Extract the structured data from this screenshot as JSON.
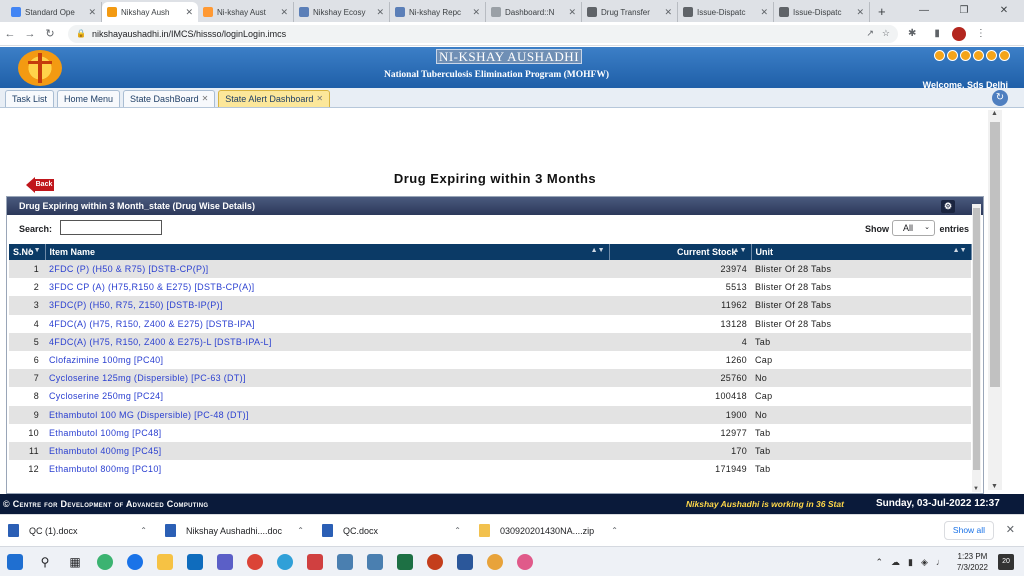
{
  "browser": {
    "tabs": [
      {
        "title": "Standard Ope",
        "color": "#4285f4",
        "active": false
      },
      {
        "title": "Nikshay Aush",
        "color": "#f39a12",
        "active": true
      },
      {
        "title": "Ni-kshay Aust",
        "color": "#ff9933",
        "active": false
      },
      {
        "title": "Nikshay Ecosy",
        "color": "#5b7fb8",
        "active": false
      },
      {
        "title": "Ni-kshay Repc",
        "color": "#5b7fb8",
        "active": false
      },
      {
        "title": "Dashboard::N",
        "color": "#9aa0a6",
        "active": false
      },
      {
        "title": "Drug Transfer",
        "color": "#5f6368",
        "active": false
      },
      {
        "title": "Issue-Dispatc",
        "color": "#5f6368",
        "active": false
      },
      {
        "title": "Issue-Dispatc",
        "color": "#5f6368",
        "active": false
      }
    ],
    "new_tab": "+",
    "url": "nikshayaushadhi.in/IMCS/hissso/loginLogin.imcs"
  },
  "app": {
    "brand": "NI-KSHAY AUSHADHI",
    "subtitle": "National Tuberculosis Elimination Program (MOHFW)",
    "welcome": "Welcome, Sds Delhi",
    "tabs": [
      {
        "label": "Task List",
        "closable": false,
        "active": false
      },
      {
        "label": "Home Menu",
        "closable": false,
        "active": false
      },
      {
        "label": "State DashBoard",
        "closable": true,
        "active": false
      },
      {
        "label": "State Alert Dashboard",
        "closable": true,
        "active": true
      }
    ]
  },
  "content": {
    "back_label": "Back",
    "title": "Drug Expiring within 3 Months",
    "panel_title": "Drug Expiring within 3 Month_state (Drug Wise Details)",
    "search_label": "Search:",
    "search_value": "",
    "show_label": "Show",
    "show_value": "All",
    "entries_label": "entries",
    "columns": [
      "S.No",
      "Item Name",
      "Current Stock",
      "Unit"
    ],
    "rows": [
      {
        "sno": "1",
        "item": "2FDC (P) (H50 & R75) [DSTB-CP(P)]",
        "stock": "23974",
        "unit": "Blister Of 28 Tabs"
      },
      {
        "sno": "2",
        "item": "3FDC CP (A) (H75,R150 & E275) [DSTB-CP(A)]",
        "stock": "5513",
        "unit": "Blister Of 28 Tabs"
      },
      {
        "sno": "3",
        "item": "3FDC(P) (H50, R75, Z150) [DSTB-IP(P)]",
        "stock": "11962",
        "unit": "Blister Of 28 Tabs"
      },
      {
        "sno": "4",
        "item": "4FDC(A) (H75, R150, Z400 & E275) [DSTB-IPA]",
        "stock": "13128",
        "unit": "Blister Of 28 Tabs"
      },
      {
        "sno": "5",
        "item": "4FDC(A) (H75, R150, Z400 & E275)-L [DSTB-IPA-L]",
        "stock": "4",
        "unit": "Tab"
      },
      {
        "sno": "6",
        "item": "Clofazimine 100mg [PC40]",
        "stock": "1260",
        "unit": "Cap"
      },
      {
        "sno": "7",
        "item": "Cycloserine 125mg (Dispersible) [PC-63 (DT)]",
        "stock": "25760",
        "unit": "No"
      },
      {
        "sno": "8",
        "item": "Cycloserine 250mg [PC24]",
        "stock": "100418",
        "unit": "Cap"
      },
      {
        "sno": "9",
        "item": "Ethambutol 100 MG (Dispersible) [PC-48 (DT)]",
        "stock": "1900",
        "unit": "No"
      },
      {
        "sno": "10",
        "item": "Ethambutol 100mg [PC48]",
        "stock": "12977",
        "unit": "Tab"
      },
      {
        "sno": "11",
        "item": "Ethambutol 400mg [PC45]",
        "stock": "170",
        "unit": "Tab"
      },
      {
        "sno": "12",
        "item": "Ethambutol 800mg [PC10]",
        "stock": "171949",
        "unit": "Tab"
      }
    ]
  },
  "footer": {
    "org": "Centre for Development of Advanced Computing",
    "marquee": "Nikshay Aushadhi is working in 36 Stat",
    "datetime": "Sunday, 03-Jul-2022 12:37"
  },
  "downloads": {
    "items": [
      {
        "name": "QC (1).docx",
        "type": "doc"
      },
      {
        "name": "Nikshay Aushadhi....doc",
        "type": "doc"
      },
      {
        "name": "QC.docx",
        "type": "doc"
      },
      {
        "name": "030920201430NA....zip",
        "type": "zip"
      }
    ],
    "show_all": "Show all"
  },
  "taskbar": {
    "time": "1:23 PM",
    "date": "7/3/2022",
    "notifications": "20"
  }
}
